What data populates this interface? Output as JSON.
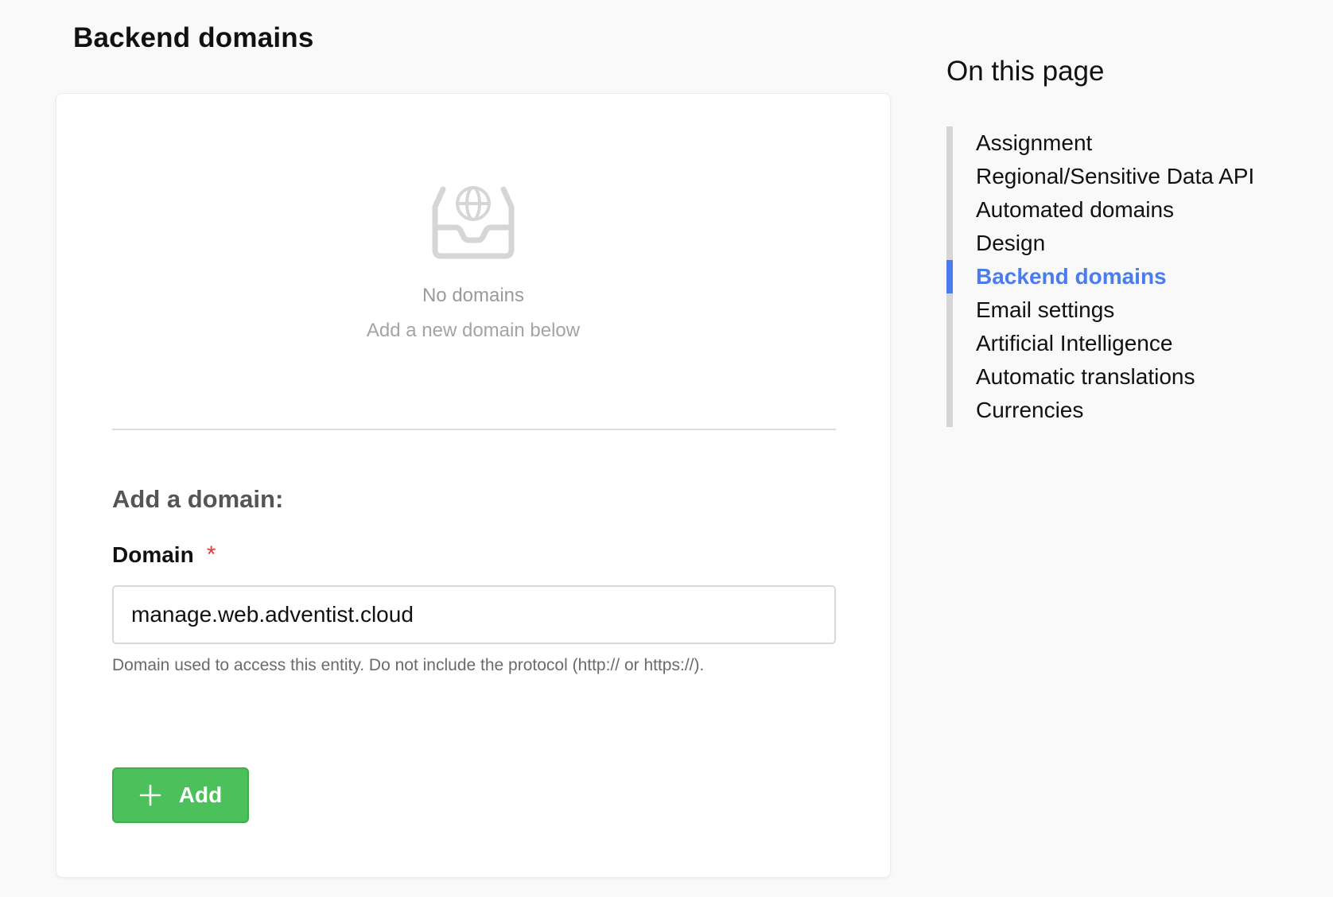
{
  "page": {
    "title": "Backend domains"
  },
  "empty_state": {
    "icon": "inbox-globe-icon",
    "title": "No domains",
    "subtitle": "Add a new domain below"
  },
  "form": {
    "heading": "Add a domain:",
    "field_label": "Domain",
    "required_marker": "*",
    "input_value": "manage.web.adventist.cloud",
    "help_text": "Domain used to access this entity. Do not include the protocol (http:// or https://).",
    "add_label": "Add",
    "add_icon": "plus-icon"
  },
  "toc": {
    "title": "On this page",
    "items": [
      {
        "label": "Assignment",
        "active": false
      },
      {
        "label": "Regional/Sensitive Data API",
        "active": false
      },
      {
        "label": "Automated domains",
        "active": false
      },
      {
        "label": "Design",
        "active": false
      },
      {
        "label": "Backend domains",
        "active": true
      },
      {
        "label": "Email settings",
        "active": false
      },
      {
        "label": "Artificial Intelligence",
        "active": false
      },
      {
        "label": "Automatic translations",
        "active": false
      },
      {
        "label": "Currencies",
        "active": false
      }
    ]
  },
  "colors": {
    "accent": "#4a7cf0",
    "button": "#4cc05a",
    "required": "#e53935",
    "background": "#f9f9f9"
  }
}
